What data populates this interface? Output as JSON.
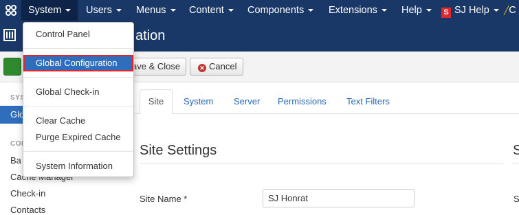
{
  "navbar": {
    "items": [
      {
        "label": "System"
      },
      {
        "label": "Users"
      },
      {
        "label": "Menus"
      },
      {
        "label": "Content"
      },
      {
        "label": "Components"
      },
      {
        "label": "Extensions"
      },
      {
        "label": "Help"
      }
    ],
    "sj_badge": "S",
    "sj_help": "SJ Help",
    "cut_item": "C"
  },
  "header": {
    "title": "Global Configuration",
    "visible_title": "ation"
  },
  "toolbar": {
    "save_close": "ave & Close",
    "cancel": "Cancel"
  },
  "sidebar": {
    "system_heading": "SYS",
    "active_item": "Glo",
    "component_heading": "COM",
    "items": [
      {
        "label": "Ba"
      },
      {
        "label": "Cache Manager"
      },
      {
        "label": "Check-in"
      },
      {
        "label": "Contacts"
      }
    ]
  },
  "tabs": [
    {
      "label": "Site"
    },
    {
      "label": "System"
    },
    {
      "label": "Server"
    },
    {
      "label": "Permissions"
    },
    {
      "label": "Text Filters"
    }
  ],
  "main": {
    "section_title": "Site Settings",
    "section_title2": "S",
    "site_name_label": "Site Name *",
    "site_name_value": "SJ Honrat",
    "label2": "S"
  },
  "dropdown": {
    "items": [
      {
        "label": "Control Panel"
      },
      {
        "label": "Global Configuration"
      },
      {
        "label": "Global Check-in"
      },
      {
        "label": "Clear Cache"
      },
      {
        "label": "Purge Expired Cache"
      },
      {
        "label": "System Information"
      }
    ]
  },
  "colors": {
    "navbar_bg": "#1a3867",
    "active_blue": "#2f6ebd",
    "highlight_border": "#e0262d",
    "link_blue": "#2a69b8"
  },
  "icons": {
    "brand": "joomla-logo-icon",
    "header": "config-sliders-icon",
    "cancel": "cancel-icon",
    "caret": "chevron-down-icon"
  }
}
